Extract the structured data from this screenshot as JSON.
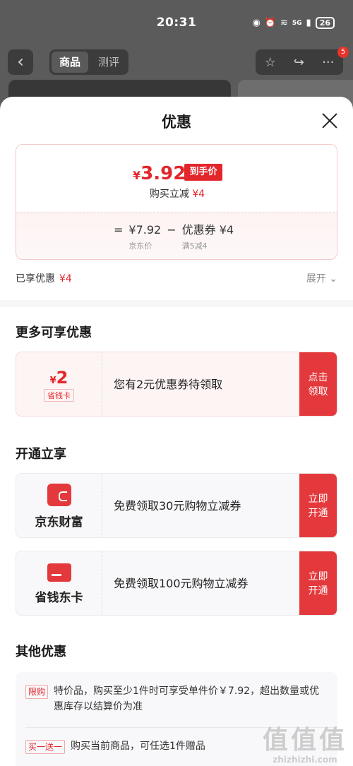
{
  "status": {
    "time": "20:31",
    "signal": "5G",
    "battery": "26"
  },
  "topnav": {
    "tab_active": "商品",
    "tab_other": "测评",
    "badge_count": "5"
  },
  "sheet": {
    "title": "优惠",
    "price": {
      "final_symbol": "¥",
      "final_value": "3.92",
      "final_tag": "到手价",
      "instant_label": "购买立减",
      "instant_value": "¥4",
      "eq": "=",
      "jd_price": "¥7.92",
      "jd_price_label": "京东价",
      "minus": "−",
      "coupon": "优惠券 ¥4",
      "coupon_rule": "满5减4"
    },
    "enjoyed_label": "已享优惠",
    "enjoyed_value": "¥4",
    "expand_label": "展开",
    "more_title": "更多可享优惠",
    "coupon_card": {
      "symbol": "¥",
      "amount": "2",
      "tag": "省钱卡",
      "text": "您有2元优惠券待领取",
      "btn_line1": "点击",
      "btn_line2": "领取"
    },
    "open_title": "开通立享",
    "open_cards": [
      {
        "name": "京东财富",
        "text": "免费领取30元购物立减券",
        "btn_line1": "立即",
        "btn_line2": "开通"
      },
      {
        "name": "省钱东卡",
        "text": "免费领取100元购物立减券",
        "btn_line1": "立即",
        "btn_line2": "开通"
      }
    ],
    "other_title": "其他优惠",
    "other_items": [
      {
        "tag": "限购",
        "text": "特价品，购买至少1件时可享受单件价￥7.92，超出数量或优惠库存以结算价为准"
      },
      {
        "tag": "买一送一",
        "text": "购买当前商品，可任选1件赠品"
      }
    ]
  },
  "watermark": {
    "big": "值值值",
    "small": "zhizhizhi.com"
  },
  "colors": {
    "accent": "#e3262b",
    "overlay": "#5b5b5b"
  }
}
